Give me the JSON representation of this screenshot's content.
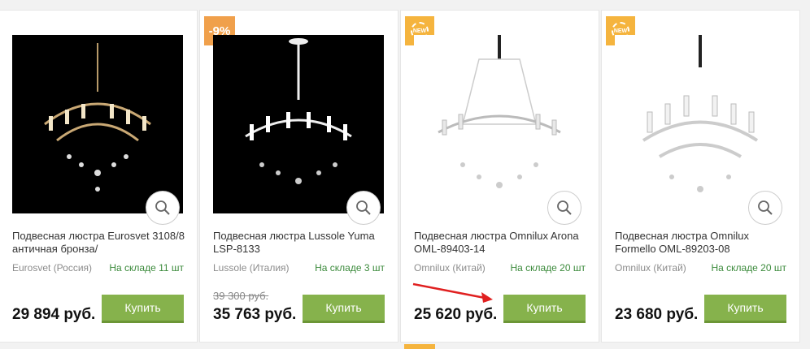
{
  "products": [
    {
      "title": "Подвесная люстра Eurosvet 3108/8 античная бронза/",
      "brand": "Eurosvet (Россия)",
      "stock": "На складе 11 шт",
      "old_price": "",
      "price": "29 894 руб.",
      "buy_label": "Купить",
      "badge": ""
    },
    {
      "title": "Подвесная люстра Lussole Yuma LSP-8133",
      "brand": "Lussole (Италия)",
      "stock": "На складе 3 шт",
      "old_price": "39 300 руб.",
      "price": "35 763 руб.",
      "buy_label": "Купить",
      "badge": "-9%"
    },
    {
      "title": "Подвесная люстра Omnilux Arona OML-89403-14",
      "brand": "Omnilux (Китай)",
      "stock": "На складе 20 шт",
      "old_price": "",
      "price": "25 620 руб.",
      "buy_label": "Купить",
      "badge": "NEW"
    },
    {
      "title": "Подвесная люстра Omnilux Formello OML-89203-08",
      "brand": "Omnilux (Китай)",
      "stock": "На складе 20 шт",
      "old_price": "",
      "price": "23 680 руб.",
      "buy_label": "Купить",
      "badge": "NEW"
    }
  ],
  "colors": {
    "buy_button": "#86b24c",
    "sale_badge": "#f0a04b",
    "new_badge": "#f5b43e",
    "stock_text": "#3b8a3b",
    "annotation_arrow": "#e02020"
  },
  "icons": {
    "zoom": "magnifier-icon",
    "new_badge": "new-seal-icon",
    "annotation": "arrow-icon"
  }
}
